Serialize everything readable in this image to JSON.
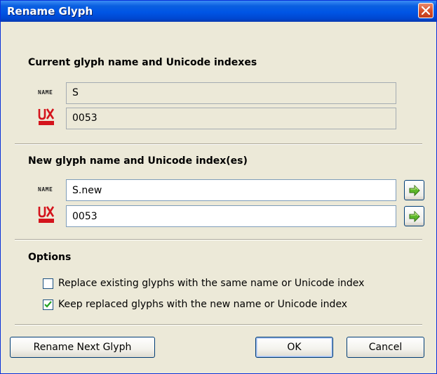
{
  "dialog": {
    "title": "Rename Glyph"
  },
  "current": {
    "heading": "Current glyph name and Unicode indexes",
    "name_icon_label": "NAME",
    "unicode_icon_label": "UNICODE",
    "name_value": "S",
    "unicode_value": "0053"
  },
  "new": {
    "heading": "New glyph name and Unicode index(es)",
    "name_icon_label": "NAME",
    "unicode_icon_label": "UNICODE",
    "name_value": "S.new",
    "unicode_value": "0053"
  },
  "options": {
    "heading": "Options",
    "replace_existing": {
      "label": "Replace existing glyphs with the same name or Unicode index",
      "checked": false
    },
    "keep_replaced": {
      "label": "Keep replaced glyphs with the new name or Unicode index",
      "checked": true
    }
  },
  "buttons": {
    "rename_next": "Rename Next Glyph",
    "ok": "OK",
    "cancel": "Cancel"
  },
  "colors": {
    "titlebar": "#0055e5",
    "dialog_bg": "#ece9d8",
    "unicode_icon": "#d4141c",
    "check": "#21a121"
  },
  "icons": {
    "close": "close-icon",
    "name": "name-tag-icon",
    "unicode": "unicode-icon",
    "go": "green-arrow-icon"
  }
}
